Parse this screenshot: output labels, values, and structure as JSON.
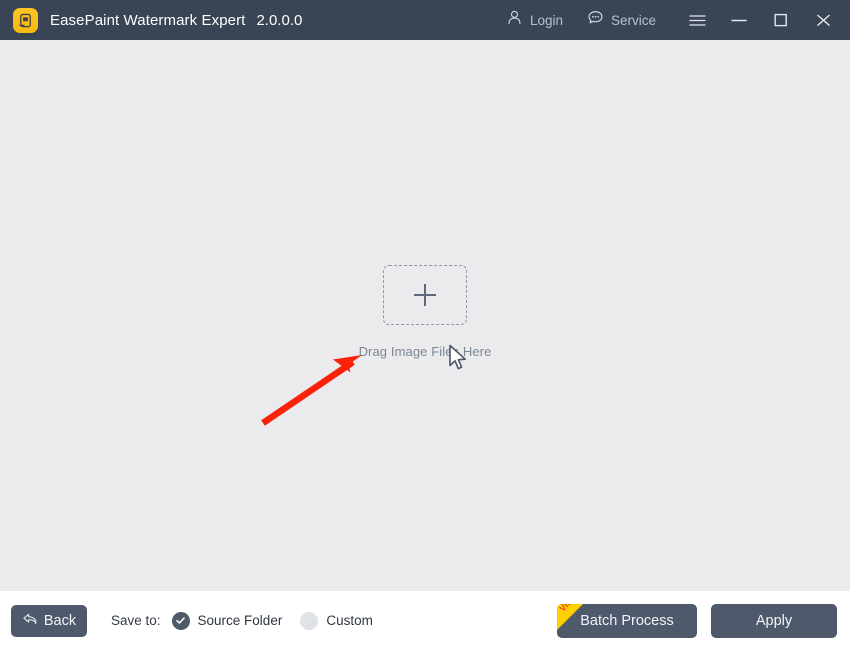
{
  "window": {
    "app_icon": "app-logo-icon",
    "title": "EasePaint Watermark Expert",
    "version": "2.0.0.0",
    "login": {
      "icon": "user-icon",
      "label": "Login"
    },
    "service": {
      "icon": "chat-bubble-icon",
      "label": "Service"
    },
    "menu_icon": "hamburger-menu-icon",
    "minimize_icon": "minimize-icon",
    "maximize_icon": "maximize-icon",
    "close_icon": "close-icon"
  },
  "content": {
    "dropzone": {
      "plus_icon": "plus-icon",
      "label": "Drag Image Files Here"
    },
    "cursor_icon": "mouse-pointer-icon",
    "annotation_arrow_icon": "red-arrow-annotation"
  },
  "footer": {
    "back": {
      "icon": "back-arrow-icon",
      "label": "Back"
    },
    "save_to_label": "Save to:",
    "save_options": [
      {
        "label": "Source Folder",
        "selected": true
      },
      {
        "label": "Custom",
        "selected": false
      }
    ],
    "batch_process": {
      "label": "Batch Process",
      "badge": "VIP"
    },
    "apply": {
      "label": "Apply"
    }
  },
  "colors": {
    "titlebar": "#394455",
    "content_bg": "#ebebed",
    "footer_bg": "#ffffff",
    "button": "#4e5a6b",
    "accent_yellow": "#ffd000",
    "vip_red": "#ef3a21",
    "annotation_red": "#fa2108"
  }
}
